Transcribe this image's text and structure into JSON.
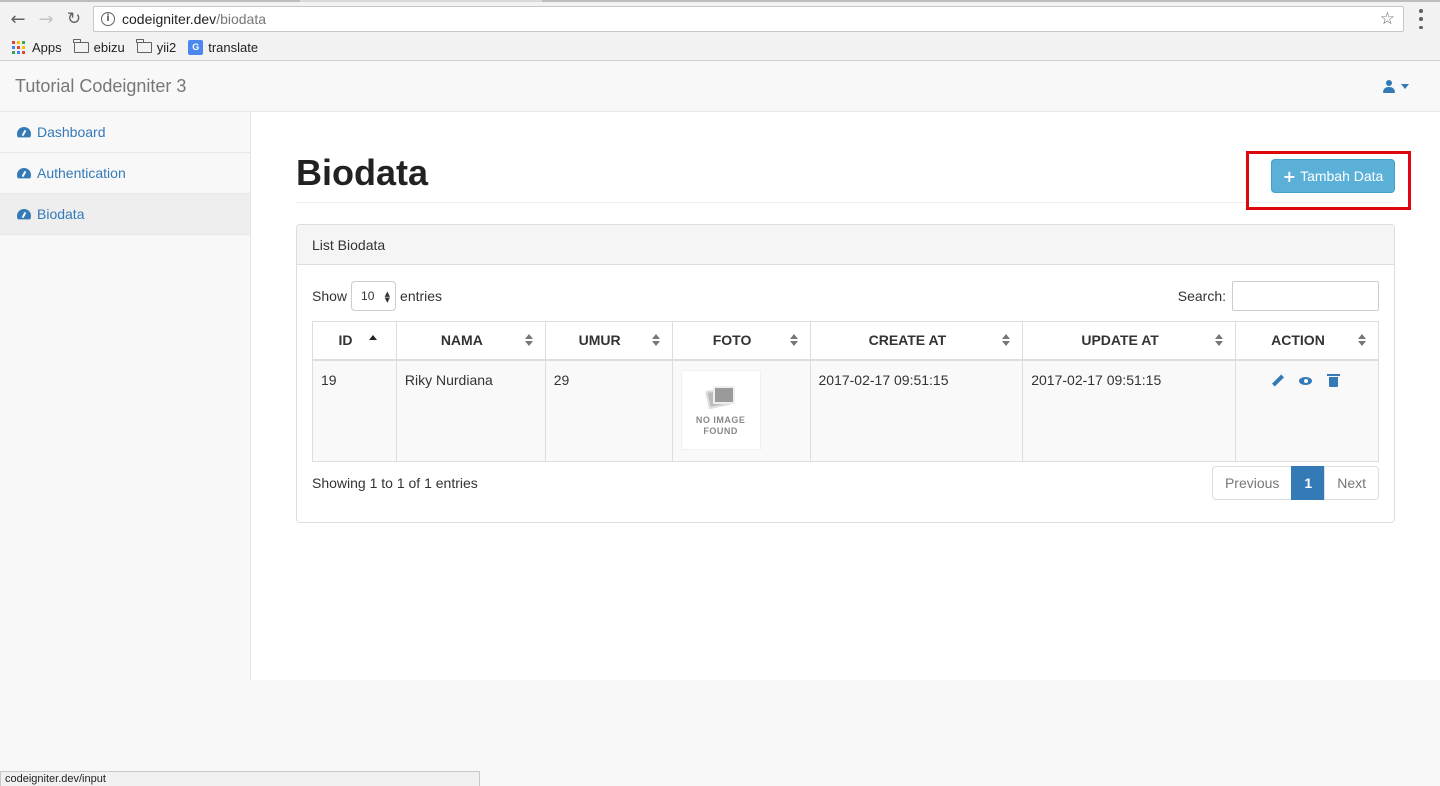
{
  "browser": {
    "url_host": "codeigniter.dev",
    "url_path": "/biodata",
    "bookmarks": [
      {
        "label": "Apps",
        "icon": "apps-grid-icon"
      },
      {
        "label": "ebizu",
        "icon": "folder-icon"
      },
      {
        "label": "yii2",
        "icon": "folder-icon"
      },
      {
        "label": "translate",
        "icon": "translate-icon"
      }
    ],
    "status_url": "codeigniter.dev/input"
  },
  "navbar": {
    "brand": "Tutorial Codeigniter 3",
    "user_icon": "user-icon"
  },
  "sidebar": {
    "items": [
      {
        "label": "Dashboard",
        "icon": "dashboard-icon",
        "active": false
      },
      {
        "label": "Authentication",
        "icon": "dashboard-icon",
        "active": false
      },
      {
        "label": "Biodata",
        "icon": "dashboard-icon",
        "active": true
      }
    ]
  },
  "page": {
    "title": "Biodata",
    "add_button": "Tambah Data",
    "highlight_color": "#e0060e",
    "accent_color": "#337ab7"
  },
  "panel": {
    "heading": "List Biodata",
    "show_label": "Show",
    "entries_label": "entries",
    "length_value": "10",
    "search_label": "Search:",
    "search_value": "",
    "columns": [
      "ID",
      "NAMA",
      "UMUR",
      "FOTO",
      "CREATE AT",
      "UPDATE AT",
      "ACTION"
    ],
    "rows": [
      {
        "id": "19",
        "nama": "Riky Nurdiana",
        "umur": "29",
        "foto_line1": "NO IMAGE",
        "foto_line2": "FOUND",
        "create_at": "2017-02-17 09:51:15",
        "update_at": "2017-02-17 09:51:15",
        "actions": [
          "edit-icon",
          "view-icon",
          "delete-icon"
        ]
      }
    ],
    "info": "Showing 1 to 1 of 1 entries",
    "pagination": {
      "previous": "Previous",
      "current": "1",
      "next": "Next"
    }
  }
}
